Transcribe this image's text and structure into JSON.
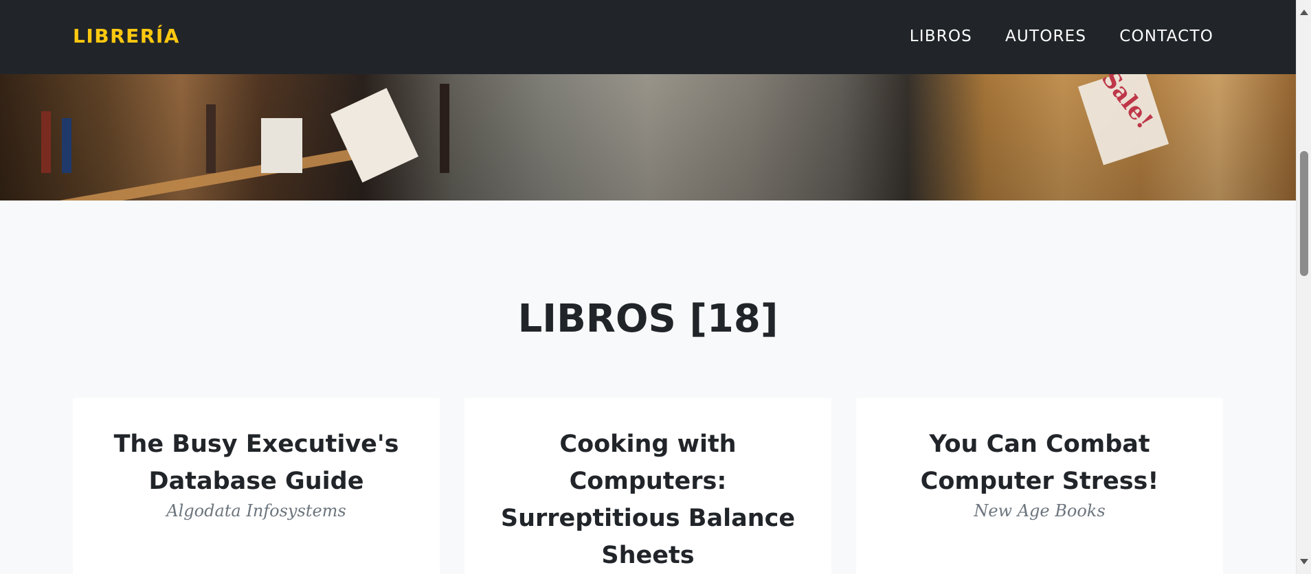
{
  "navbar": {
    "brand": "LIBRERÍA",
    "links": [
      "LIBROS",
      "AUTORES",
      "CONTACTO"
    ]
  },
  "hero": {
    "sign_text": "Sale!"
  },
  "section": {
    "title": "LIBROS [18]"
  },
  "books": [
    {
      "title": "The Busy Executive's Database Guide",
      "publisher": "Algodata Infosystems"
    },
    {
      "title": "Cooking with Computers: Surreptitious Balance Sheets",
      "publisher": ""
    },
    {
      "title": "You Can Combat Computer Stress!",
      "publisher": "New Age Books"
    }
  ],
  "colors": {
    "navbar_bg": "#212529",
    "brand": "#fec810",
    "page_bg": "#f8f9fa",
    "card_bg": "#ffffff",
    "text_dark": "#212529",
    "text_muted": "#6c757d"
  }
}
